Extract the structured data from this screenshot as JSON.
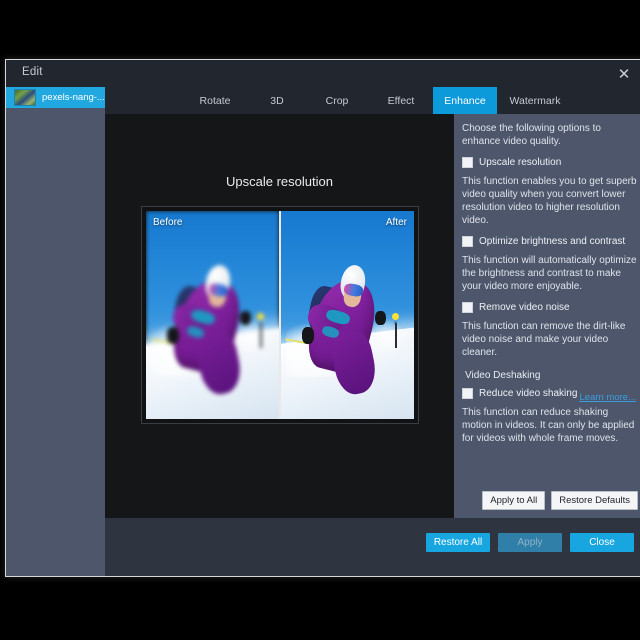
{
  "window": {
    "title": "Edit",
    "close_icon": "close-icon"
  },
  "sidebar": {
    "items": [
      {
        "label": "pexels-nang-...",
        "thumbnail": "video-thumbnail"
      }
    ]
  },
  "tabs": [
    {
      "label": "Rotate",
      "active": false
    },
    {
      "label": "3D",
      "active": false
    },
    {
      "label": "Crop",
      "active": false
    },
    {
      "label": "Effect",
      "active": false
    },
    {
      "label": "Enhance",
      "active": true
    },
    {
      "label": "Watermark",
      "active": false
    }
  ],
  "preview": {
    "title": "Upscale resolution",
    "before_label": "Before",
    "after_label": "After"
  },
  "options_panel": {
    "intro": "Choose the following options to enhance video quality.",
    "items": [
      {
        "label": "Upscale resolution",
        "checked": false,
        "description": "This function enables you to get superb video quality when you convert lower resolution video to higher resolution video."
      },
      {
        "label": "Optimize brightness and contrast",
        "checked": false,
        "description": "This function will automatically optimize the brightness and contrast to make your video more enjoyable."
      },
      {
        "label": "Remove video noise",
        "checked": false,
        "description": "This function can remove the dirt-like video noise and make your video cleaner."
      }
    ],
    "section_title": "Video Deshaking",
    "deshake": {
      "label": "Reduce video shaking",
      "checked": false,
      "description": "This function can reduce shaking motion in videos. It can only be applied for videos with whole frame moves."
    },
    "learn_more": "Learn more...",
    "apply_to_all": "Apply to All",
    "restore_defaults": "Restore Defaults"
  },
  "footer": {
    "restore_all": "Restore All",
    "apply": "Apply",
    "close": "Close"
  },
  "colors": {
    "accent": "#17a6e0",
    "tab_active": "#0c9ada",
    "panel": "#4d566a",
    "titlebar": "#22262f",
    "canvas": "#151617",
    "footer": "#2e3440",
    "link": "#3a9fe0"
  }
}
